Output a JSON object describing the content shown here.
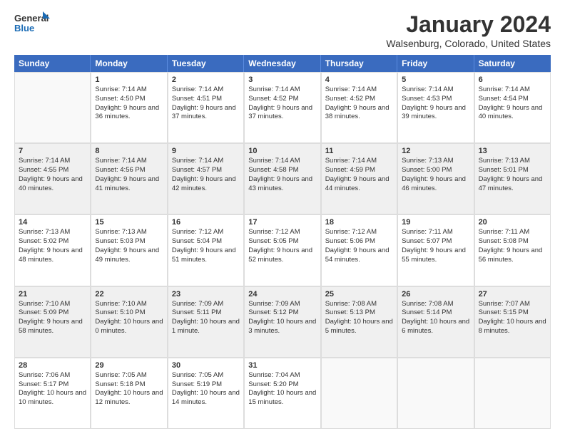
{
  "logo": {
    "general": "General",
    "blue": "Blue"
  },
  "title": "January 2024",
  "location": "Walsenburg, Colorado, United States",
  "days_of_week": [
    "Sunday",
    "Monday",
    "Tuesday",
    "Wednesday",
    "Thursday",
    "Friday",
    "Saturday"
  ],
  "weeks": [
    [
      {
        "day": "",
        "sunrise": "",
        "sunset": "",
        "daylight": ""
      },
      {
        "day": "1",
        "sunrise": "Sunrise: 7:14 AM",
        "sunset": "Sunset: 4:50 PM",
        "daylight": "Daylight: 9 hours and 36 minutes."
      },
      {
        "day": "2",
        "sunrise": "Sunrise: 7:14 AM",
        "sunset": "Sunset: 4:51 PM",
        "daylight": "Daylight: 9 hours and 37 minutes."
      },
      {
        "day": "3",
        "sunrise": "Sunrise: 7:14 AM",
        "sunset": "Sunset: 4:52 PM",
        "daylight": "Daylight: 9 hours and 37 minutes."
      },
      {
        "day": "4",
        "sunrise": "Sunrise: 7:14 AM",
        "sunset": "Sunset: 4:52 PM",
        "daylight": "Daylight: 9 hours and 38 minutes."
      },
      {
        "day": "5",
        "sunrise": "Sunrise: 7:14 AM",
        "sunset": "Sunset: 4:53 PM",
        "daylight": "Daylight: 9 hours and 39 minutes."
      },
      {
        "day": "6",
        "sunrise": "Sunrise: 7:14 AM",
        "sunset": "Sunset: 4:54 PM",
        "daylight": "Daylight: 9 hours and 40 minutes."
      }
    ],
    [
      {
        "day": "7",
        "sunrise": "Sunrise: 7:14 AM",
        "sunset": "Sunset: 4:55 PM",
        "daylight": "Daylight: 9 hours and 40 minutes."
      },
      {
        "day": "8",
        "sunrise": "Sunrise: 7:14 AM",
        "sunset": "Sunset: 4:56 PM",
        "daylight": "Daylight: 9 hours and 41 minutes."
      },
      {
        "day": "9",
        "sunrise": "Sunrise: 7:14 AM",
        "sunset": "Sunset: 4:57 PM",
        "daylight": "Daylight: 9 hours and 42 minutes."
      },
      {
        "day": "10",
        "sunrise": "Sunrise: 7:14 AM",
        "sunset": "Sunset: 4:58 PM",
        "daylight": "Daylight: 9 hours and 43 minutes."
      },
      {
        "day": "11",
        "sunrise": "Sunrise: 7:14 AM",
        "sunset": "Sunset: 4:59 PM",
        "daylight": "Daylight: 9 hours and 44 minutes."
      },
      {
        "day": "12",
        "sunrise": "Sunrise: 7:13 AM",
        "sunset": "Sunset: 5:00 PM",
        "daylight": "Daylight: 9 hours and 46 minutes."
      },
      {
        "day": "13",
        "sunrise": "Sunrise: 7:13 AM",
        "sunset": "Sunset: 5:01 PM",
        "daylight": "Daylight: 9 hours and 47 minutes."
      }
    ],
    [
      {
        "day": "14",
        "sunrise": "Sunrise: 7:13 AM",
        "sunset": "Sunset: 5:02 PM",
        "daylight": "Daylight: 9 hours and 48 minutes."
      },
      {
        "day": "15",
        "sunrise": "Sunrise: 7:13 AM",
        "sunset": "Sunset: 5:03 PM",
        "daylight": "Daylight: 9 hours and 49 minutes."
      },
      {
        "day": "16",
        "sunrise": "Sunrise: 7:12 AM",
        "sunset": "Sunset: 5:04 PM",
        "daylight": "Daylight: 9 hours and 51 minutes."
      },
      {
        "day": "17",
        "sunrise": "Sunrise: 7:12 AM",
        "sunset": "Sunset: 5:05 PM",
        "daylight": "Daylight: 9 hours and 52 minutes."
      },
      {
        "day": "18",
        "sunrise": "Sunrise: 7:12 AM",
        "sunset": "Sunset: 5:06 PM",
        "daylight": "Daylight: 9 hours and 54 minutes."
      },
      {
        "day": "19",
        "sunrise": "Sunrise: 7:11 AM",
        "sunset": "Sunset: 5:07 PM",
        "daylight": "Daylight: 9 hours and 55 minutes."
      },
      {
        "day": "20",
        "sunrise": "Sunrise: 7:11 AM",
        "sunset": "Sunset: 5:08 PM",
        "daylight": "Daylight: 9 hours and 56 minutes."
      }
    ],
    [
      {
        "day": "21",
        "sunrise": "Sunrise: 7:10 AM",
        "sunset": "Sunset: 5:09 PM",
        "daylight": "Daylight: 9 hours and 58 minutes."
      },
      {
        "day": "22",
        "sunrise": "Sunrise: 7:10 AM",
        "sunset": "Sunset: 5:10 PM",
        "daylight": "Daylight: 10 hours and 0 minutes."
      },
      {
        "day": "23",
        "sunrise": "Sunrise: 7:09 AM",
        "sunset": "Sunset: 5:11 PM",
        "daylight": "Daylight: 10 hours and 1 minute."
      },
      {
        "day": "24",
        "sunrise": "Sunrise: 7:09 AM",
        "sunset": "Sunset: 5:12 PM",
        "daylight": "Daylight: 10 hours and 3 minutes."
      },
      {
        "day": "25",
        "sunrise": "Sunrise: 7:08 AM",
        "sunset": "Sunset: 5:13 PM",
        "daylight": "Daylight: 10 hours and 5 minutes."
      },
      {
        "day": "26",
        "sunrise": "Sunrise: 7:08 AM",
        "sunset": "Sunset: 5:14 PM",
        "daylight": "Daylight: 10 hours and 6 minutes."
      },
      {
        "day": "27",
        "sunrise": "Sunrise: 7:07 AM",
        "sunset": "Sunset: 5:15 PM",
        "daylight": "Daylight: 10 hours and 8 minutes."
      }
    ],
    [
      {
        "day": "28",
        "sunrise": "Sunrise: 7:06 AM",
        "sunset": "Sunset: 5:17 PM",
        "daylight": "Daylight: 10 hours and 10 minutes."
      },
      {
        "day": "29",
        "sunrise": "Sunrise: 7:05 AM",
        "sunset": "Sunset: 5:18 PM",
        "daylight": "Daylight: 10 hours and 12 minutes."
      },
      {
        "day": "30",
        "sunrise": "Sunrise: 7:05 AM",
        "sunset": "Sunset: 5:19 PM",
        "daylight": "Daylight: 10 hours and 14 minutes."
      },
      {
        "day": "31",
        "sunrise": "Sunrise: 7:04 AM",
        "sunset": "Sunset: 5:20 PM",
        "daylight": "Daylight: 10 hours and 15 minutes."
      },
      {
        "day": "",
        "sunrise": "",
        "sunset": "",
        "daylight": ""
      },
      {
        "day": "",
        "sunrise": "",
        "sunset": "",
        "daylight": ""
      },
      {
        "day": "",
        "sunrise": "",
        "sunset": "",
        "daylight": ""
      }
    ]
  ]
}
